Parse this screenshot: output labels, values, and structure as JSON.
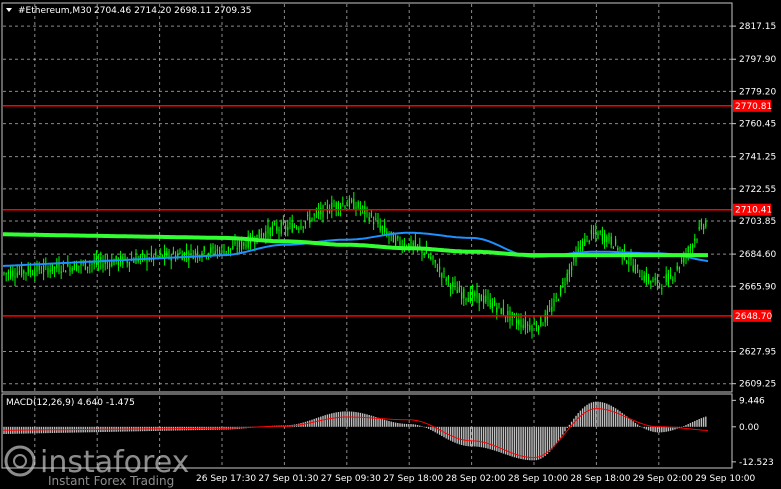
{
  "header": {
    "symbol": "#Ethereum,M30",
    "ohlc": "2704.46 2714.20 2698.11 2709.35"
  },
  "price_axis": {
    "ticks": [
      "2817.15",
      "2797.90",
      "2779.20",
      "2760.45",
      "2741.25",
      "2722.55",
      "2703.85",
      "2684.60",
      "2665.90",
      "2627.95",
      "2609.25"
    ]
  },
  "time_axis": {
    "ticks": [
      "26 Sep 17:30",
      "27 Sep 01:30",
      "27 Sep 09:30",
      "27 Sep 18:00",
      "28 Sep 02:00",
      "28 Sep 10:00",
      "28 Sep 18:00",
      "29 Sep 02:00",
      "29 Sep 10:00"
    ]
  },
  "levels": [
    {
      "value": 2770.81,
      "label": "2770.81",
      "color": "#ff0000"
    },
    {
      "value": 2710.41,
      "label": "2710.41",
      "color": "#ff0000"
    },
    {
      "value": 2648.7,
      "label": "2648.70",
      "color": "#ff0000"
    }
  ],
  "macd": {
    "title": "MACD(12,26,9) 4.640 -1.475",
    "ticks": [
      "9.446",
      "0.00",
      "-12.523"
    ]
  },
  "watermark": {
    "brand": "instaforex",
    "tagline": "Instant Forex Trading"
  },
  "colors": {
    "background": "#000000",
    "grid": "#c8c8c8",
    "candles": "#00ff00",
    "ma_fast": "#1e90ff",
    "ma_slow": "#32ff32",
    "macd_hist": "#c0c0c0",
    "macd_signal": "#ff0000",
    "level": "#ff0000"
  },
  "chart_data": {
    "type": "line",
    "title": "#Ethereum,M30",
    "ylim": [
      2605,
      2830
    ],
    "x": [
      "26 Sep 17:30",
      "27 Sep 01:30",
      "27 Sep 09:30",
      "27 Sep 18:00",
      "28 Sep 02:00",
      "28 Sep 10:00",
      "28 Sep 18:00",
      "29 Sep 02:00",
      "29 Sep 10:00"
    ],
    "series": [
      {
        "values": [
          2687,
          2700,
          2714,
          2690,
          2660,
          2643,
          2696,
          2668,
          2709
        ]
      },
      {
        "values": [
          2684,
          2690,
          2693,
          2697,
          2694,
          2683,
          2686,
          2685,
          2680
        ]
      },
      {
        "values": [
          2694,
          2692,
          2690,
          2688,
          2686,
          2684,
          2684,
          2684,
          2684
        ]
      }
    ],
    "macd": {
      "ylim": [
        -14,
        11
      ],
      "histogram": [
        -1.0,
        0.5,
        5.5,
        1.0,
        -7.0,
        -12.0,
        9.0,
        -2.0,
        4.6
      ],
      "signal": [
        -0.5,
        0.2,
        3.5,
        2.5,
        -5.0,
        -11.0,
        6.5,
        0.0,
        -1.5
      ]
    }
  }
}
